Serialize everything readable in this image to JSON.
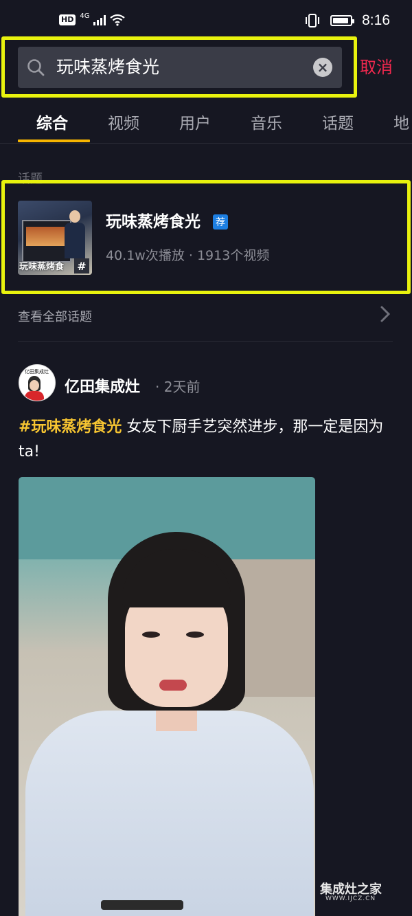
{
  "status_bar": {
    "hd": "HD",
    "network": "4G",
    "time": "8:16",
    "battery_level": 0.9
  },
  "search": {
    "query": "玩味蒸烤食光",
    "cancel_label": "取消"
  },
  "tabs": [
    {
      "label": "综合",
      "active": true
    },
    {
      "label": "视频",
      "active": false
    },
    {
      "label": "用户",
      "active": false
    },
    {
      "label": "音乐",
      "active": false
    },
    {
      "label": "话题",
      "active": false
    },
    {
      "label": "地",
      "active": false
    }
  ],
  "topics_section": {
    "label": "话题",
    "topic": {
      "title": "玩味蒸烤食光",
      "badge": "荐",
      "thumb_caption": "玩味蒸烤食",
      "thumb_hash": "#",
      "stats": "40.1w次播放 · 1913个视频"
    },
    "view_all": "查看全部话题"
  },
  "post": {
    "author": "亿田集成灶",
    "time": "· 2天前",
    "hashtag": "#玩味蒸烤食光",
    "text": " 女友下厨手艺突然进步，那一定是因为ta!",
    "avatar_caption": "亿田集成灶"
  },
  "watermark": {
    "title": "集成灶之家",
    "url": "WWW.IJCZ.CN"
  },
  "colors": {
    "background": "#161722",
    "accent_yellow": "#f7b500",
    "highlight": "#e8f20e",
    "cancel_red": "#f0284e",
    "badge_blue": "#1d7fe2"
  }
}
